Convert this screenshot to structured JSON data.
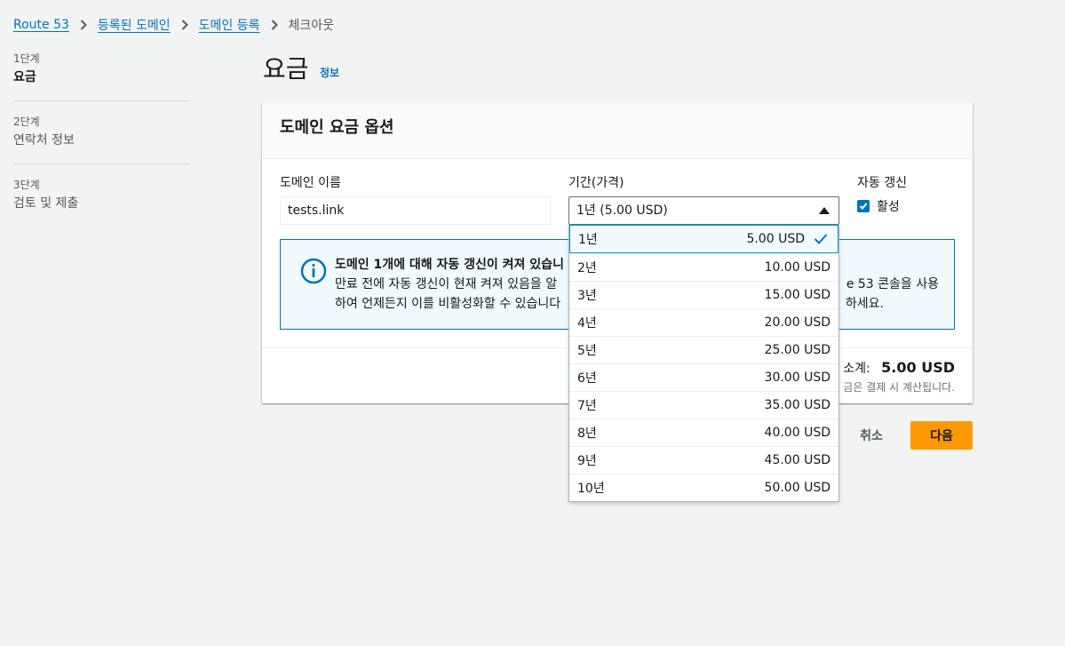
{
  "breadcrumb": {
    "items": [
      "Route 53",
      "등록된 도메인",
      "도메인 등록"
    ],
    "current": "체크아웃"
  },
  "steps": [
    {
      "num": "1단계",
      "label": "요금"
    },
    {
      "num": "2단계",
      "label": "연락처 정보"
    },
    {
      "num": "3단계",
      "label": "검토 및 제출"
    }
  ],
  "page": {
    "title": "요금",
    "info": "정보"
  },
  "panel": {
    "title": "도메인 요금 옵션",
    "domain_label": "도메인 이름",
    "domain_value": "tests.link",
    "duration_label": "기간(가격)",
    "duration_value": "1년 (5.00 USD)",
    "autorenew_label": "자동 갱신",
    "autorenew_checkbox": "활성",
    "autorenew_checked": true,
    "alert_title": "도메인 1개에 대해 자동 갱신이 켜져 있습니",
    "alert_body_line1_a": "만료 전에 자동 갱신이 현재 켜져 있음을 알",
    "alert_body_line1_b": "e 53 콘솔을 사용",
    "alert_body_line2_a": "하여 언제든지 이를 비활성화할 수 있습니다",
    "alert_body_line2_b": "하세요.",
    "subtotal_label": "소계:",
    "subtotal_value": "5.00 USD",
    "subtotal_note": "금은 결제 시 계산됩니다."
  },
  "actions": {
    "cancel": "취소",
    "next": "다음"
  },
  "dropdown": {
    "options": [
      {
        "label": "1년",
        "price": "5.00 USD",
        "selected": true
      },
      {
        "label": "2년",
        "price": "10.00 USD"
      },
      {
        "label": "3년",
        "price": "15.00 USD"
      },
      {
        "label": "4년",
        "price": "20.00 USD"
      },
      {
        "label": "5년",
        "price": "25.00 USD"
      },
      {
        "label": "6년",
        "price": "30.00 USD"
      },
      {
        "label": "7년",
        "price": "35.00 USD"
      },
      {
        "label": "8년",
        "price": "40.00 USD"
      },
      {
        "label": "9년",
        "price": "45.00 USD"
      },
      {
        "label": "10년",
        "price": "50.00 USD"
      }
    ]
  },
  "colors": {
    "link": "#0073bb",
    "primary_button": "#ff9900",
    "alert_border": "#0073bb",
    "checkbox": "#0073bb"
  }
}
